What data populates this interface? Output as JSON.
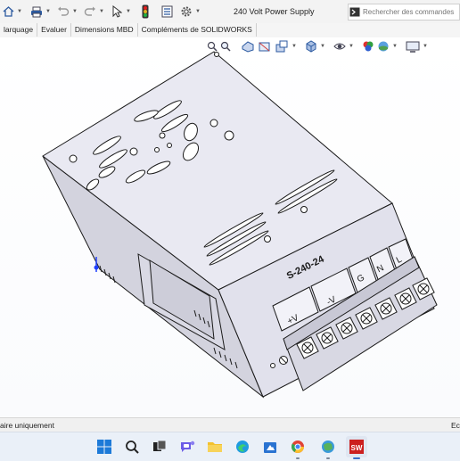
{
  "window": {
    "title": "240 Volt Power Supply",
    "search_placeholder": "Rechercher des commandes"
  },
  "quick_access": {
    "icons": [
      "solidworks-logo-icon",
      "home-icon",
      "print-icon",
      "undo-icon",
      "redo-icon",
      "select-arrow-icon",
      "rebuild-traffic-light-icon",
      "file-properties-icon",
      "options-gear-icon"
    ]
  },
  "tabs": [
    "larquage",
    "Evaluer",
    "Dimensions MBD",
    "Compléments de SOLIDWORKS"
  ],
  "heads_up_toolbar": {
    "icons": [
      "zoom-to-fit-icon",
      "zoom-area-icon",
      "previous-view-icon",
      "section-view-icon",
      "dynamic-annotation-icon",
      "view-orientation-icon",
      "display-style-icon",
      "hide-show-items-icon",
      "edit-appearance-icon",
      "apply-scene-icon",
      "view-settings-icon"
    ]
  },
  "model": {
    "label": "S-240-24",
    "terminals": [
      "+V",
      "-V",
      "G",
      "N",
      "L"
    ],
    "colors": {
      "body": "#dcdce6",
      "top": "#e9e9f2",
      "front": "#e1e1ec",
      "edge": "#1a1a1a"
    }
  },
  "statusbar": {
    "left": "aire uniquement",
    "right": "Ec"
  },
  "taskbar": {
    "icons": [
      "windows-start-icon",
      "search-icon",
      "task-view-icon",
      "teams-chat-icon",
      "file-explorer-icon",
      "edge-browser-icon",
      "microsoft-store-icon",
      "chrome-browser-icon",
      "maps-icon",
      "solidworks-app-icon"
    ],
    "active": "solidworks-app-icon"
  }
}
